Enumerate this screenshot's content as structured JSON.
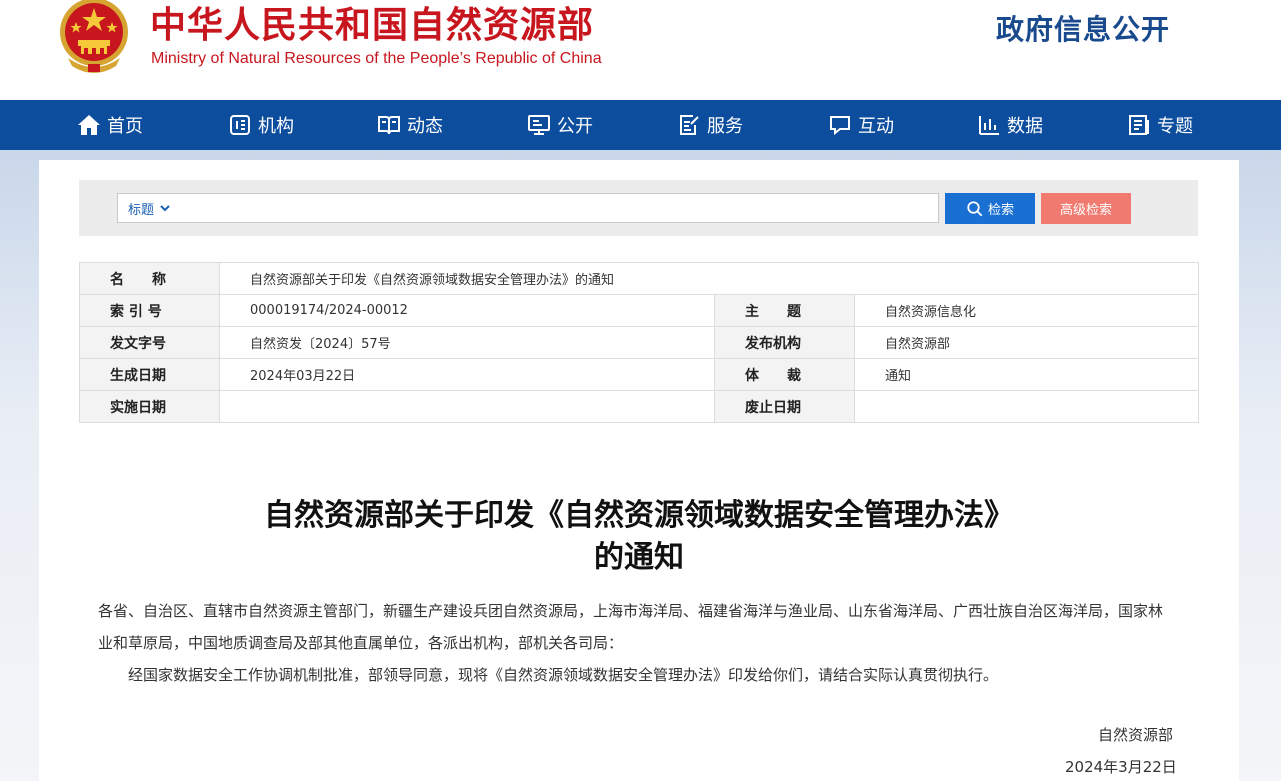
{
  "header": {
    "title_cn": "中华人民共和国自然资源部",
    "title_en": "Ministry of Natural Resources of the People’s Republic of China",
    "section": "政府信息公开"
  },
  "nav": {
    "items": [
      {
        "label": "首页",
        "icon": "home-icon"
      },
      {
        "label": "机构",
        "icon": "org-icon"
      },
      {
        "label": "动态",
        "icon": "book-icon"
      },
      {
        "label": "公开",
        "icon": "monitor-icon"
      },
      {
        "label": "服务",
        "icon": "edit-icon"
      },
      {
        "label": "互动",
        "icon": "chat-icon"
      },
      {
        "label": "数据",
        "icon": "chart-icon"
      },
      {
        "label": "专题",
        "icon": "doc-icon"
      }
    ]
  },
  "search": {
    "type_label": "标题",
    "placeholder": "",
    "search_label": "检索",
    "advanced_label": "高级检索"
  },
  "info": {
    "name_label": "名　　称",
    "name_value": "自然资源部关于印发《自然资源领域数据安全管理办法》的通知",
    "index_label": "索 引 号",
    "index_value": "000019174/2024-00012",
    "topic_label": "主　　题",
    "topic_value": "自然资源信息化",
    "docno_label": "发文字号",
    "docno_value": "自然资发〔2024〕57号",
    "publisher_label": "发布机构",
    "publisher_value": "自然资源部",
    "created_label": "生成日期",
    "created_value": "2024年03月22日",
    "genre_label": "体　　裁",
    "genre_value": "通知",
    "effective_label": "实施日期",
    "effective_value": "",
    "expiry_label": "废止日期",
    "expiry_value": ""
  },
  "article": {
    "title_line1": "自然资源部关于印发《自然资源领域数据安全管理办法》",
    "title_line2": "的通知",
    "para1": "各省、自治区、直辖市自然资源主管部门，新疆生产建设兵团自然资源局，上海市海洋局、福建省海洋与渔业局、山东省海洋局、广西壮族自治区海洋局，国家林业和草原局，中国地质调查局及部其他直属单位，各派出机构，部机关各司局：",
    "para2": "经国家数据安全工作协调机制批准，部领导同意，现将《自然资源领域数据安全管理办法》印发给你们，请结合实际认真贯彻执行。",
    "sign_org": "自然资源部",
    "sign_date": "2024年3月22日"
  },
  "colors": {
    "brand_red": "#c8161e",
    "nav_blue": "#0d4d9e",
    "search_blue": "#1a6fd3",
    "advanced_red": "#f07a70"
  }
}
